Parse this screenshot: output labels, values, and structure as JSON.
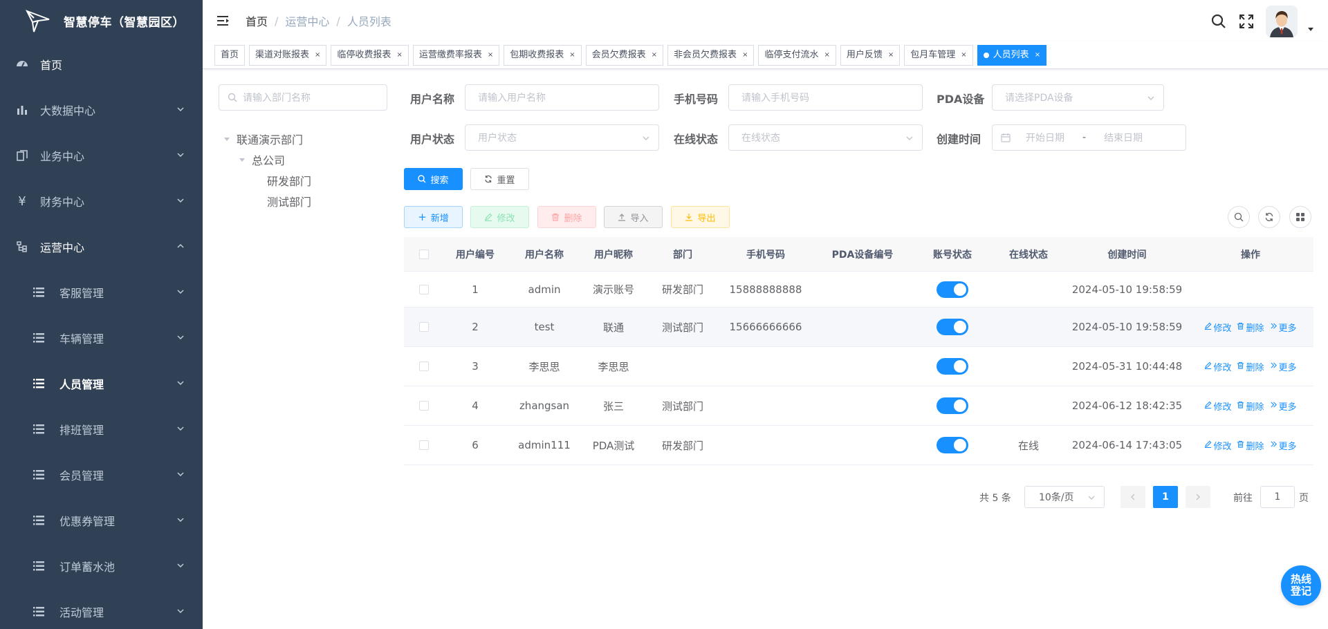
{
  "app": {
    "title": "智慧停车（智慧园区）"
  },
  "sidebar": {
    "items": [
      {
        "label": "首页",
        "icon": "dashboard-icon"
      },
      {
        "label": "大数据中心",
        "icon": "bar-chart-icon"
      },
      {
        "label": "业务中心",
        "icon": "documents-icon"
      },
      {
        "label": "财务中心",
        "icon": "yen-icon"
      },
      {
        "label": "运营中心",
        "icon": "tree-icon"
      }
    ],
    "sub_items": [
      {
        "label": "客服管理",
        "icon": "list-icon"
      },
      {
        "label": "车辆管理",
        "icon": "list-icon"
      },
      {
        "label": "人员管理",
        "icon": "list-icon"
      },
      {
        "label": "排班管理",
        "icon": "list-icon"
      },
      {
        "label": "会员管理",
        "icon": "list-icon"
      },
      {
        "label": "优惠券管理",
        "icon": "list-icon"
      },
      {
        "label": "订单蓄水池",
        "icon": "list-icon"
      },
      {
        "label": "活动管理",
        "icon": "list-icon"
      }
    ]
  },
  "breadcrumb": {
    "home": "首页",
    "center": "运营中心",
    "current": "人员列表"
  },
  "tags": [
    {
      "label": "首页"
    },
    {
      "label": "渠道对账报表"
    },
    {
      "label": "临停收费报表"
    },
    {
      "label": "运营缴费率报表"
    },
    {
      "label": "包期收费报表"
    },
    {
      "label": "会员欠费报表"
    },
    {
      "label": "非会员欠费报表"
    },
    {
      "label": "临停支付流水"
    },
    {
      "label": "用户反馈"
    },
    {
      "label": "包月车管理"
    },
    {
      "label": "人员列表"
    }
  ],
  "tag_close": "×",
  "tree": {
    "search_placeholder": "请输入部门名称",
    "root": "联通演示部门",
    "company": "总公司",
    "dept1": "研发部门",
    "dept2": "测试部门"
  },
  "filters": {
    "username_label": "用户名称",
    "username_placeholder": "请输入用户名称",
    "phone_label": "手机号码",
    "phone_placeholder": "请输入手机号码",
    "pda_label": "PDA设备",
    "pda_placeholder": "请选择PDA设备",
    "status_label": "用户状态",
    "status_placeholder": "用户状态",
    "online_label": "在线状态",
    "online_placeholder": "在线状态",
    "created_label": "创建时间",
    "start_placeholder": "开始日期",
    "date_sep": "-",
    "end_placeholder": "结束日期",
    "search_btn": "搜索",
    "reset_btn": "重置"
  },
  "toolbar": {
    "add": "新增",
    "edit": "修改",
    "delete": "删除",
    "import": "导入",
    "export": "导出"
  },
  "table": {
    "headers": [
      "用户编号",
      "用户名称",
      "用户昵称",
      "部门",
      "手机号码",
      "PDA设备编号",
      "账号状态",
      "在线状态",
      "创建时间",
      "操作"
    ],
    "rows": [
      {
        "id": "1",
        "name": "admin",
        "nick": "演示账号",
        "dept": "研发部门",
        "phone": "15888888888",
        "pda": "",
        "enabled": true,
        "online": "",
        "created": "2024-05-10 19:58:59",
        "ops": false
      },
      {
        "id": "2",
        "name": "test",
        "nick": "联通",
        "dept": "测试部门",
        "phone": "15666666666",
        "pda": "",
        "enabled": true,
        "online": "",
        "created": "2024-05-10 19:58:59",
        "ops": true
      },
      {
        "id": "3",
        "name": "李思思",
        "nick": "李思思",
        "dept": "",
        "phone": "",
        "pda": "",
        "enabled": true,
        "online": "",
        "created": "2024-05-31 10:44:48",
        "ops": true
      },
      {
        "id": "4",
        "name": "zhangsan",
        "nick": "张三",
        "dept": "测试部门",
        "phone": "",
        "pda": "",
        "enabled": true,
        "online": "",
        "created": "2024-06-12 18:42:35",
        "ops": true
      },
      {
        "id": "6",
        "name": "admin111",
        "nick": "PDA测试",
        "dept": "研发部门",
        "phone": "",
        "pda": "",
        "enabled": true,
        "online": "在线",
        "created": "2024-06-14 17:43:05",
        "ops": true
      }
    ],
    "op_edit": "修改",
    "op_delete": "删除",
    "op_more": "更多"
  },
  "pagination": {
    "total_text": "共 5 条",
    "page_size": "10条/页",
    "current_page": "1",
    "goto_label": "前往",
    "goto_value": "1",
    "page_suffix": "页"
  },
  "hotline": {
    "line1": "热线",
    "line2": "登记"
  },
  "colors": {
    "primary": "#1890ff",
    "sidebar_bg": "#304156",
    "sidebar_text": "#bfcbd9"
  }
}
